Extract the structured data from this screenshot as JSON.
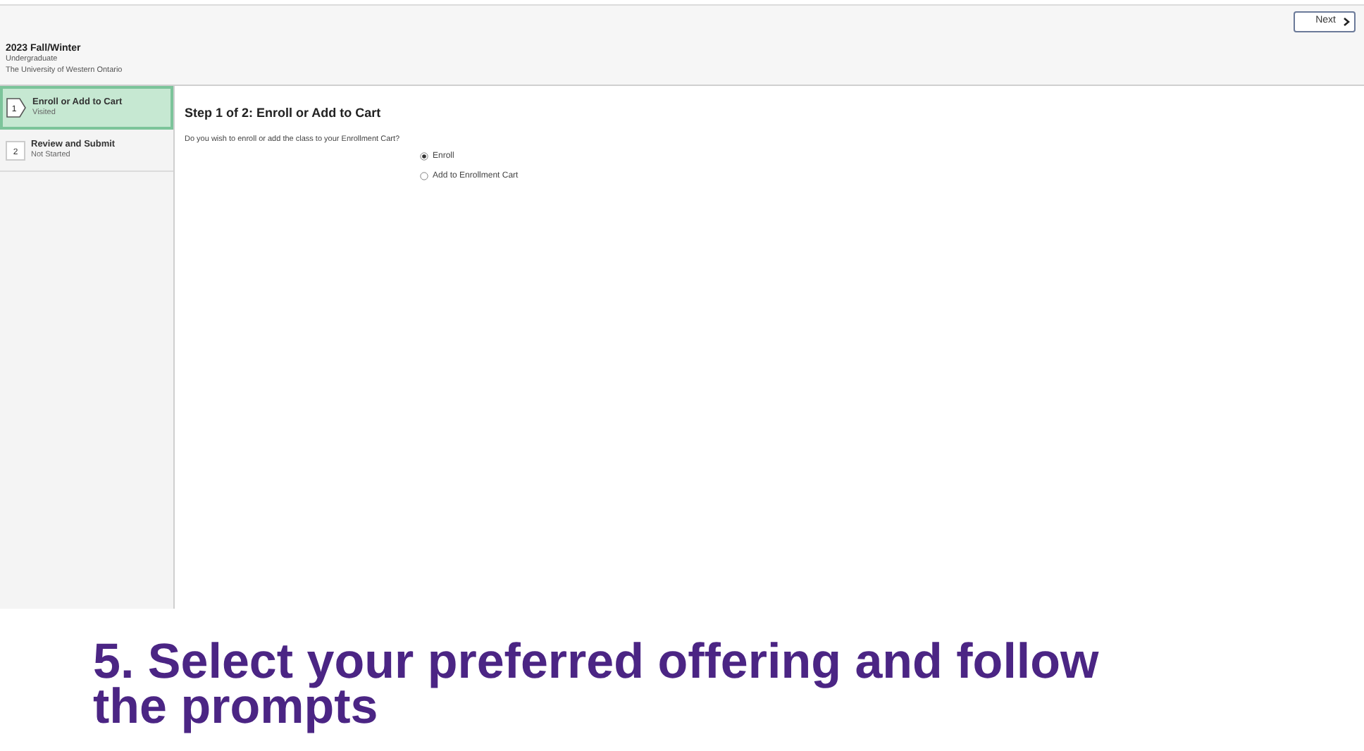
{
  "header": {
    "next_button": "Next",
    "term": "2023 Fall/Winter",
    "career": "Undergraduate",
    "institution": "The University of Western Ontario"
  },
  "steps": [
    {
      "number": "1",
      "title": "Enroll or Add to Cart",
      "status": "Visited",
      "selected": true
    },
    {
      "number": "2",
      "title": "Review and Submit",
      "status": "Not Started",
      "selected": false
    }
  ],
  "main": {
    "heading": "Step 1 of 2: Enroll or Add to Cart",
    "question": "Do you wish to enroll or add the class to your Enrollment Cart?",
    "options": [
      {
        "label": "Enroll",
        "selected": true
      },
      {
        "label": "Add to Enrollment Cart",
        "selected": false
      }
    ]
  },
  "caption": "5. Select your preferred offering and follow the prompts"
}
